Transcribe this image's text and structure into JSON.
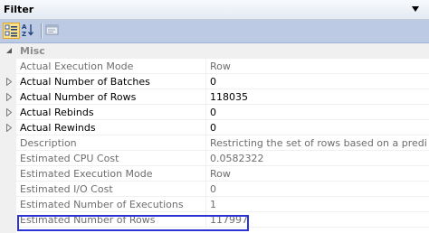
{
  "window": {
    "title": "Filter"
  },
  "toolbar": {
    "categorized_icon": "categorized-icon",
    "alphabetical_icon": "alphabetical-icon",
    "property_pages_icon": "property-pages-icon"
  },
  "category": {
    "label": "Misc"
  },
  "properties": [
    {
      "name": "Actual Execution Mode",
      "value": "Row",
      "expandable": false,
      "readonly": true
    },
    {
      "name": "Actual Number of Batches",
      "value": "0",
      "expandable": true,
      "readonly": false
    },
    {
      "name": "Actual Number of Rows",
      "value": "118035",
      "expandable": true,
      "readonly": false
    },
    {
      "name": "Actual Rebinds",
      "value": "0",
      "expandable": true,
      "readonly": false
    },
    {
      "name": "Actual Rewinds",
      "value": "0",
      "expandable": true,
      "readonly": false
    },
    {
      "name": "Description",
      "value": "Restricting the set of rows based on a predicate.",
      "expandable": false,
      "readonly": true
    },
    {
      "name": "Estimated CPU Cost",
      "value": "0.0582322",
      "expandable": false,
      "readonly": true
    },
    {
      "name": "Estimated Execution Mode",
      "value": "Row",
      "expandable": false,
      "readonly": true
    },
    {
      "name": "Estimated I/O Cost",
      "value": "0",
      "expandable": false,
      "readonly": true
    },
    {
      "name": "Estimated Number of Executions",
      "value": "1",
      "expandable": false,
      "readonly": true
    },
    {
      "name": "Estimated Number of Rows",
      "value": "117997",
      "expandable": false,
      "readonly": true
    }
  ],
  "colors": {
    "highlight_border": "#2c34d6",
    "toolbar_bg": "#bccbe3",
    "readonly_text": "#6d6d6d"
  }
}
